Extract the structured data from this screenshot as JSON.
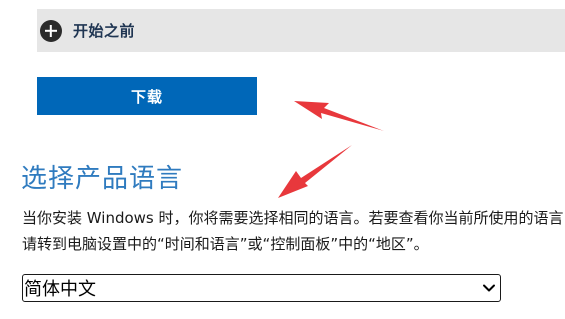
{
  "expander": {
    "label": "开始之前",
    "icon": "plus-circle-icon"
  },
  "download": {
    "label": "下载"
  },
  "section": {
    "title": "选择产品语言",
    "description": "当你安装 Windows 时，你将需要选择相同的语言。若要查看你当前所使用的语言，请转到电脑设置中的“时间和语言”或“控制面板”中的“地区”。"
  },
  "language_select": {
    "selected": "简体中文",
    "icon": "chevron-down-icon"
  },
  "colors": {
    "accent": "#0067b8",
    "title": "#2f7bbf",
    "annotation": "#e8383c"
  }
}
